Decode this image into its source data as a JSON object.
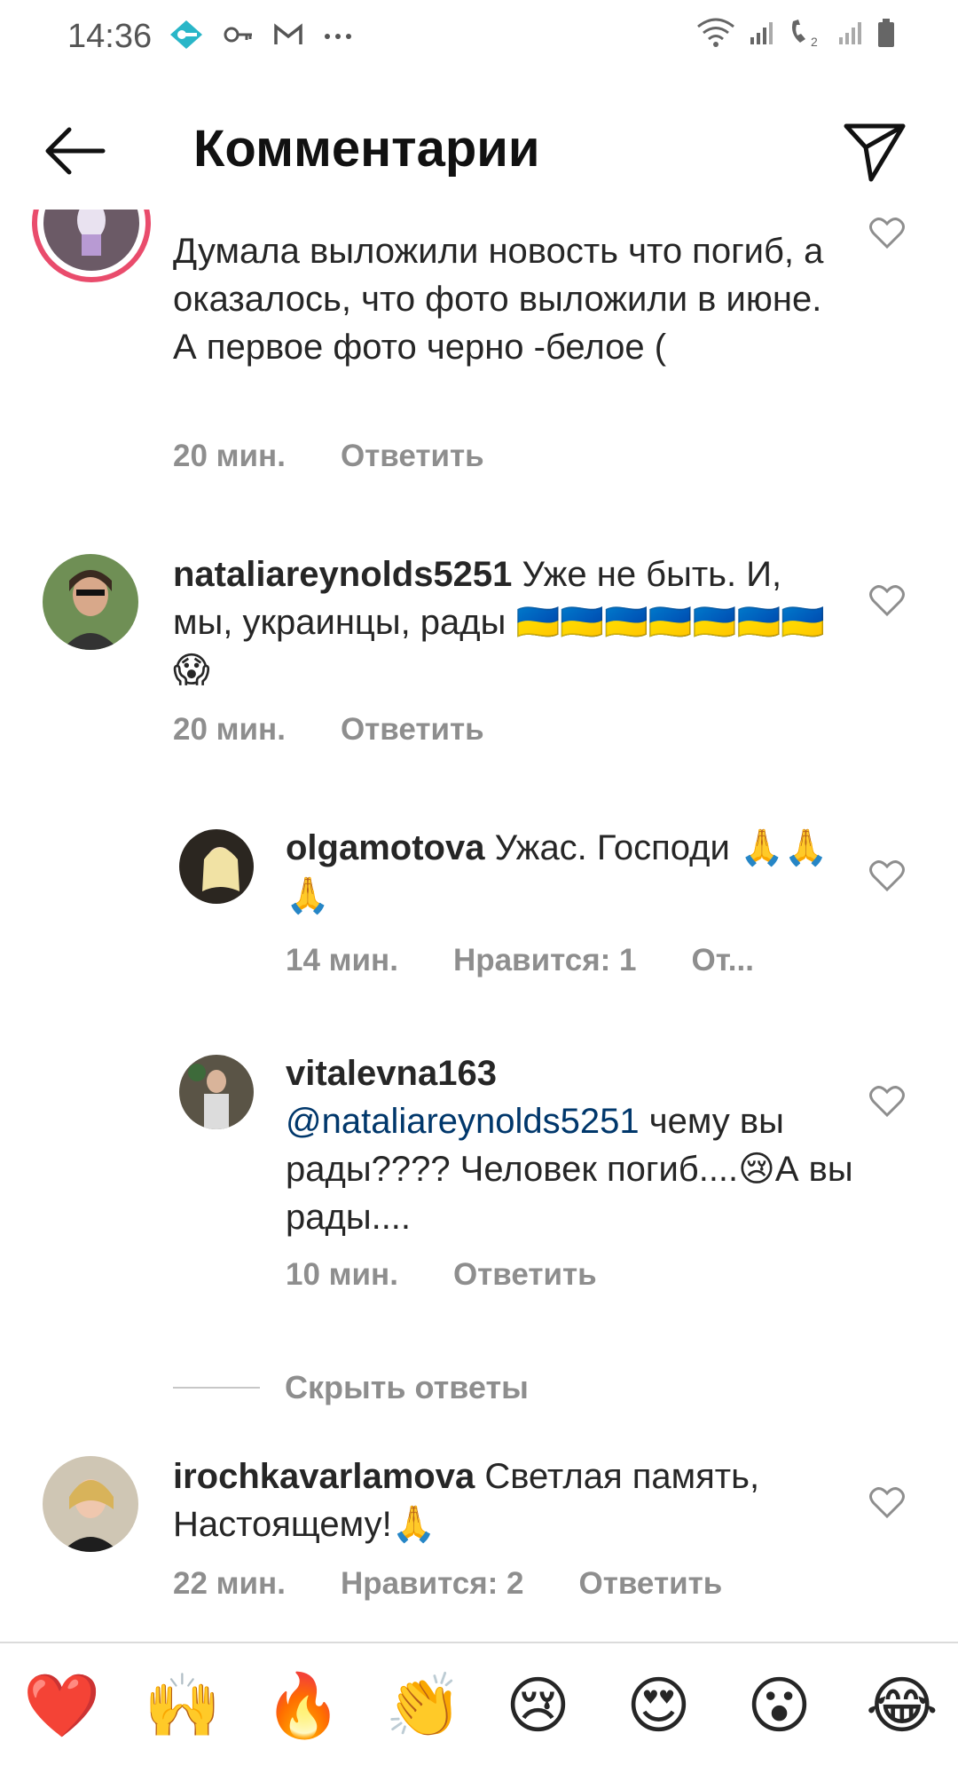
{
  "status_bar": {
    "time": "14:36"
  },
  "header": {
    "title": "Комментарии"
  },
  "comments": [
    {
      "text": "Думала выложили новость что погиб, а оказалось, что фото выложили в июне. А первое фото черно -белое (",
      "time": "20 мин.",
      "reply": "Ответить"
    },
    {
      "username": "nataliareynolds5251",
      "text": " Уже не быть. И, мы, украинцы, рады 🇺🇦🇺🇦🇺🇦🇺🇦🇺🇦🇺🇦🇺🇦😱",
      "time": "20 мин.",
      "reply": "Ответить"
    },
    {
      "username": "olgamotova",
      "text": " Ужас. Господи 🙏🙏🙏",
      "time": "14 мин.",
      "likes": "Нравится: 1",
      "reply": "От..."
    },
    {
      "username": "vitalevna163",
      "mention": "@nataliareynolds5251",
      "text": " чему вы рады???? Человек погиб....😢А вы рады....",
      "time": "10 мин.",
      "reply": "Ответить"
    },
    {
      "username": "irochkavarlamova",
      "text": " Светлая память, Настоящему!🙏",
      "time": "22 мин.",
      "likes": "Нравится: 2",
      "reply": "Ответить"
    }
  ],
  "hide_replies": "Скрыть ответы",
  "emoji_bar": [
    "❤️",
    "🙌",
    "🔥",
    "👏",
    "😢",
    "😍",
    "😮",
    "😂"
  ]
}
